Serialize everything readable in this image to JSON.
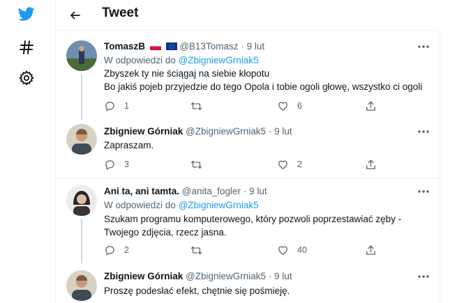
{
  "header": {
    "title": "Tweet"
  },
  "nav": {
    "icons": [
      "twitter-logo-icon",
      "hashtag-icon",
      "gear-icon"
    ]
  },
  "colors": {
    "accent": "#1d9bf0",
    "text": "#0f1419",
    "muted": "#536471",
    "divider": "#eff3f4"
  },
  "tweets": [
    {
      "name": "TomaszB",
      "flags": [
        "poland-flag",
        "eu-flag"
      ],
      "handle": "@B13Tomasz",
      "separator": "·",
      "date": "9 lut",
      "reply_prefix": "W odpowiedzi do",
      "reply_mention": "@ZbigniewGrniak5",
      "text_lines": [
        "Zbyszek ty nie ściągaj na siebie kłopotu",
        "Bo jakiś pojeb przyjedzie do tego Opola i tobie ogoli głowę, wszystko ci ogoli"
      ],
      "replies": "1",
      "retweets": "",
      "likes": "6"
    },
    {
      "name": "Zbigniew Górniak",
      "handle": "@ZbigniewGrniak5",
      "separator": "·",
      "date": "9 lut",
      "text_lines": [
        "Zapraszam."
      ],
      "replies": "3",
      "retweets": "",
      "likes": "2"
    },
    {
      "name": "Ani ta, ani tamta.",
      "handle": "@anita_fogler",
      "separator": "·",
      "date": "9 lut",
      "reply_prefix": "W odpowiedzi do",
      "reply_mention": "@ZbigniewGrniak5",
      "text_lines": [
        "Szukam programu komputerowego, który pozwoli poprzestawiać zęby  -",
        "Twojego zdjęcia, rzecz jasna."
      ],
      "replies": "2",
      "retweets": "",
      "likes": "40"
    },
    {
      "name": "Zbigniew Górniak",
      "handle": "@ZbigniewGrniak5",
      "separator": "·",
      "date": "9 lut",
      "text_lines": [
        "Proszę podesłać efekt, chętnie się pośmieję."
      ]
    }
  ]
}
